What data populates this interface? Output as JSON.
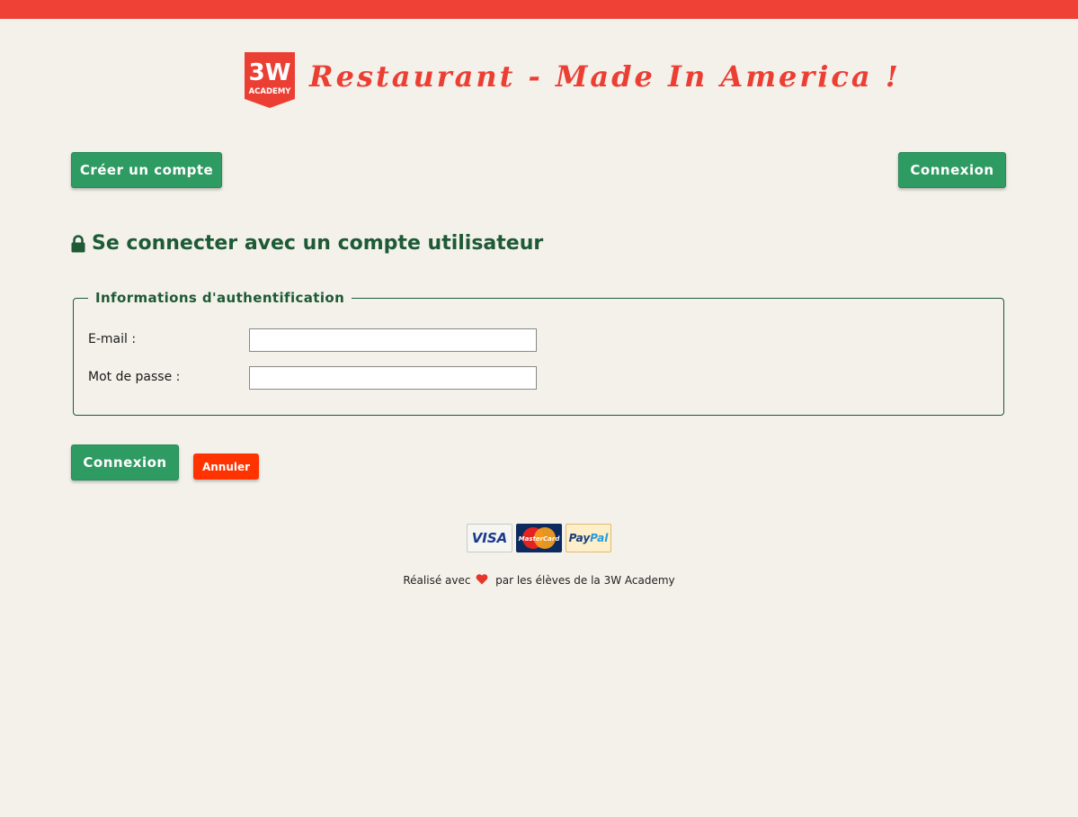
{
  "header": {
    "logo_text_top": "3W",
    "logo_text_bottom": "ACADEMY",
    "title": "Restaurant - Made In America !"
  },
  "nav": {
    "create_account_label": "Créer un compte",
    "login_label": "Connexion"
  },
  "page": {
    "heading": "Se connecter avec un compte utilisateur"
  },
  "form": {
    "legend": "Informations d'authentification",
    "email_label": "E-mail :",
    "email_value": "",
    "password_label": "Mot de passe :",
    "password_value": "",
    "submit_label": "Connexion",
    "cancel_label": "Annuler"
  },
  "payments": {
    "visa": "VISA",
    "mastercard": "MasterCard",
    "paypal_pay": "Pay",
    "paypal_pal": "Pal"
  },
  "footer": {
    "made_with": "Réalisé avec",
    "by_students": "par les élèves de la 3W Academy"
  },
  "colors": {
    "topbar": "#f04137",
    "title": "#ec3f34",
    "primary_button": "#2e9b62",
    "cancel_button": "#ff3300",
    "heading": "#1e5a35",
    "background": "#f3f1ea"
  }
}
